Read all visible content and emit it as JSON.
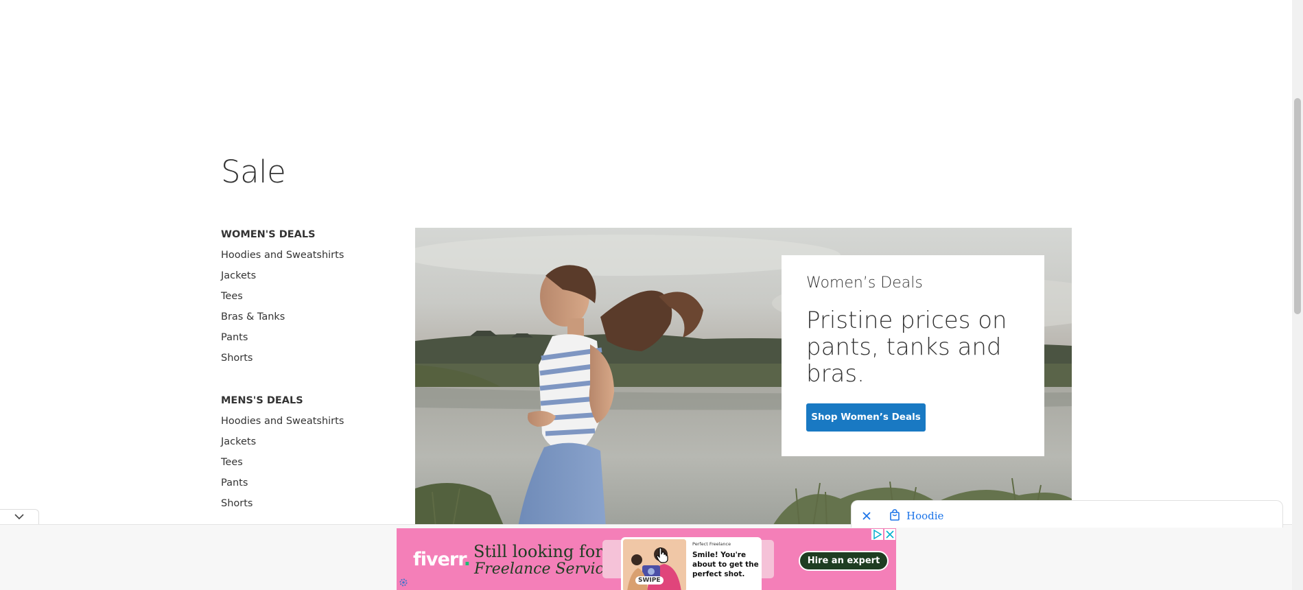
{
  "page": {
    "title": "Sale"
  },
  "sidebar": {
    "groups": [
      {
        "heading": "WOMEN'S DEALS",
        "items": [
          "Hoodies and Sweatshirts",
          "Jackets",
          "Tees",
          "Bras & Tanks",
          "Pants",
          "Shorts"
        ]
      },
      {
        "heading": "MENS'S DEALS",
        "items": [
          "Hoodies and Sweatshirts",
          "Jackets",
          "Tees",
          "Pants",
          "Shorts"
        ]
      }
    ]
  },
  "hero": {
    "kicker": "Women’s Deals",
    "headline": "Pristine prices on pants, tanks and bras.",
    "button_label": "Shop Women’s Deals",
    "button_color": "#1979c3"
  },
  "widget": {
    "label": "Hoodie",
    "close_icon": "close-icon",
    "bag_icon": "shopping-bag-icon"
  },
  "ad": {
    "logo": "fiverr",
    "logo_dot": ".",
    "line1": "Still looking for",
    "line2": "Freelance Services?",
    "card_tag": "Perfect Freelance",
    "card_text": "Smile! You're about to get the perfect shot.",
    "swipe_label": "SWIPE",
    "cta": "Hire an expert",
    "background": "#f47fb8"
  }
}
